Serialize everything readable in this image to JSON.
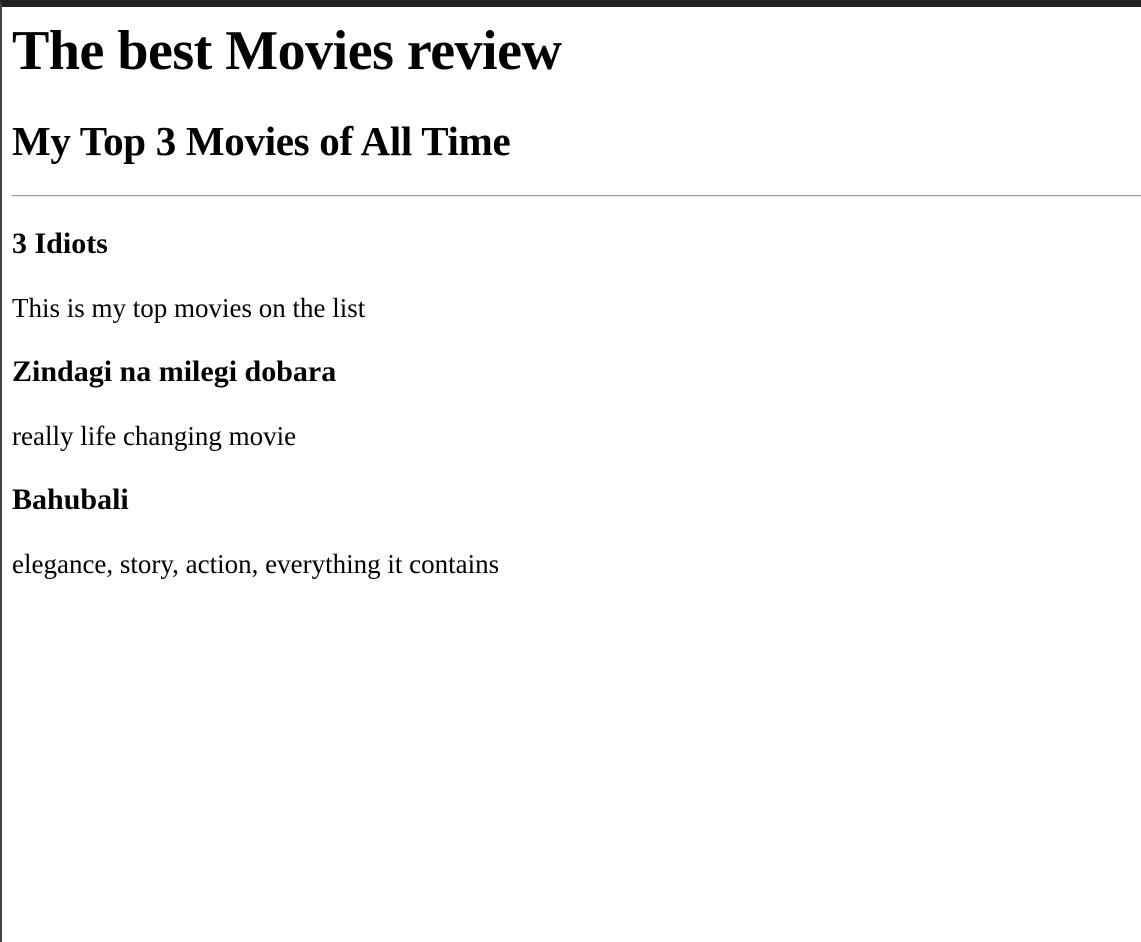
{
  "page": {
    "title": "The best Movies review",
    "subtitle": "My Top 3 Movies of All Time"
  },
  "movies": [
    {
      "title": "3 Idiots",
      "description": "This is my top movies on the list"
    },
    {
      "title": "Zindagi na milegi dobara",
      "description": "really life changing movie"
    },
    {
      "title": "Bahubali",
      "description": "elegance, story, action, everything it contains"
    }
  ]
}
